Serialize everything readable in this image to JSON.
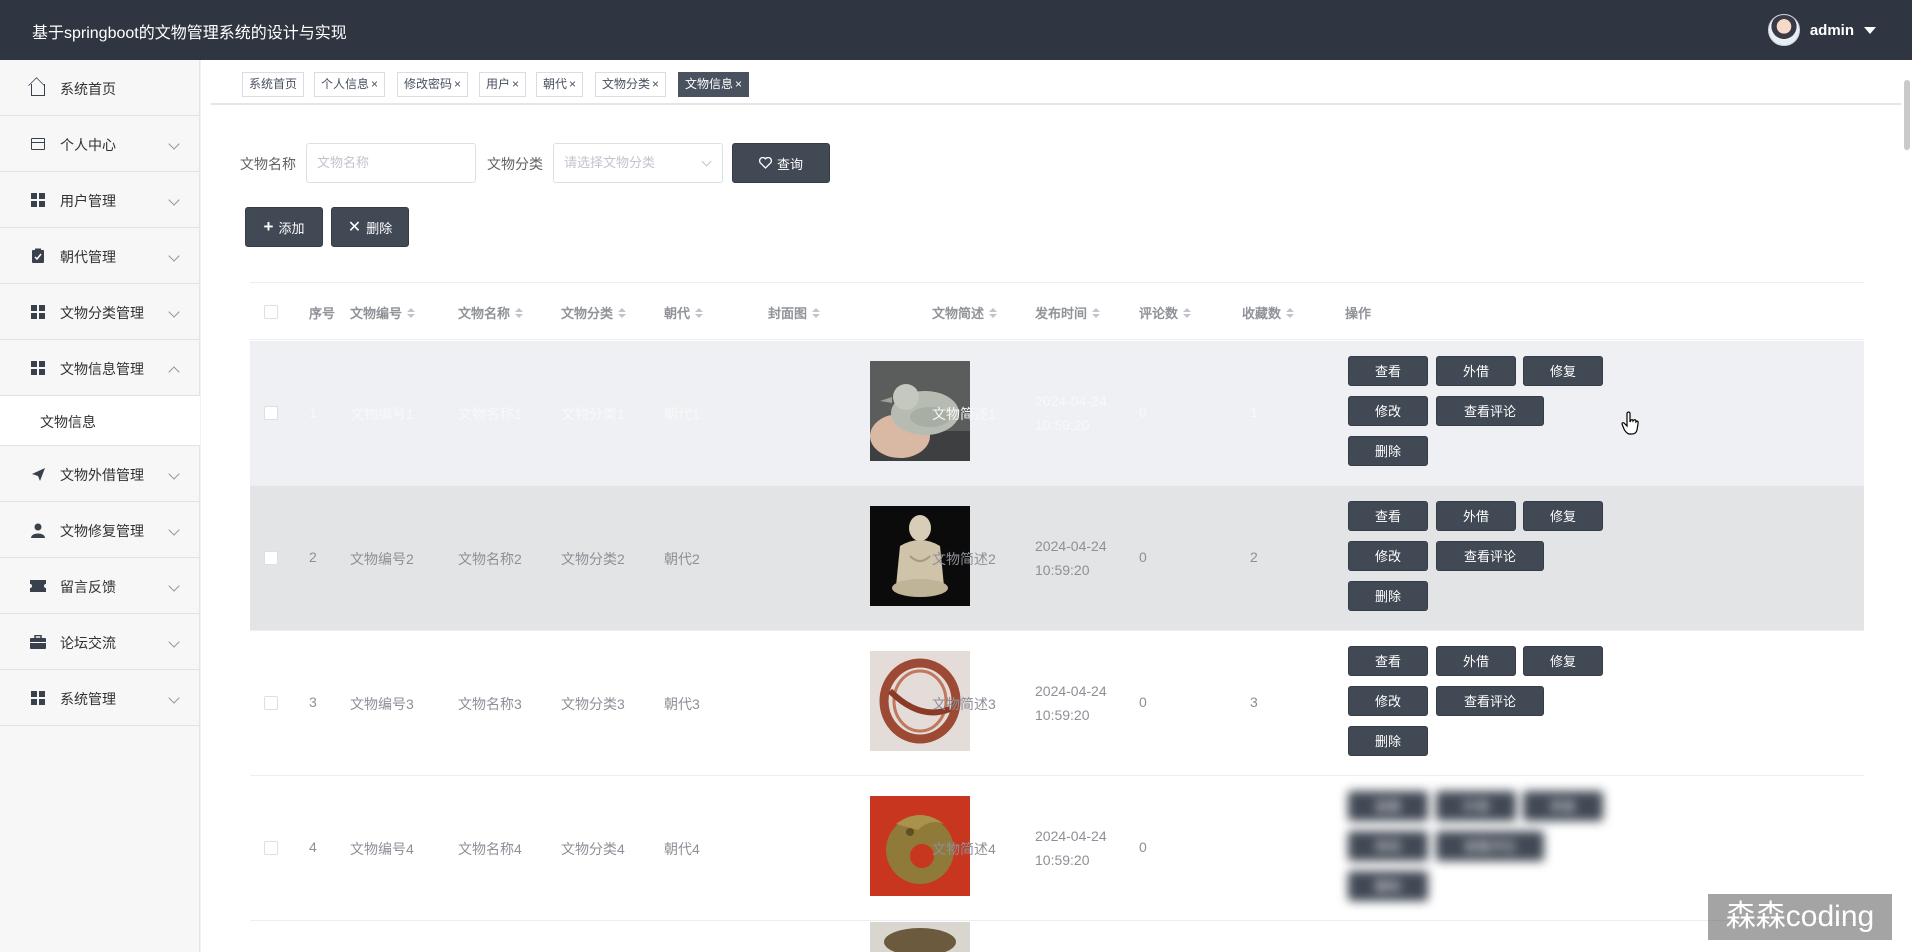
{
  "header": {
    "title": "基于springboot的文物管理系统的设计与实现",
    "username": "admin"
  },
  "sidebar": {
    "items": [
      {
        "label": "系统首页",
        "icon": "home-icon"
      },
      {
        "label": "个人中心",
        "icon": "card-icon"
      },
      {
        "label": "用户管理",
        "icon": "grid-icon"
      },
      {
        "label": "朝代管理",
        "icon": "clipboard-icon"
      },
      {
        "label": "文物分类管理",
        "icon": "grid-icon"
      },
      {
        "label": "文物信息管理",
        "icon": "grid-icon"
      },
      {
        "label": "文物外借管理",
        "icon": "send-icon"
      },
      {
        "label": "文物修复管理",
        "icon": "user-icon"
      },
      {
        "label": "留言反馈",
        "icon": "ticket-icon"
      },
      {
        "label": "论坛交流",
        "icon": "briefcase-icon"
      },
      {
        "label": "系统管理",
        "icon": "grid-icon"
      }
    ],
    "subitem": "文物信息"
  },
  "tabs": [
    "系统首页",
    "个人信息",
    "修改密码",
    "用户",
    "朝代",
    "文物分类",
    "文物信息"
  ],
  "tab_close": "×",
  "search": {
    "name_label": "文物名称",
    "name_placeholder": "文物名称",
    "category_label": "文物分类",
    "category_placeholder": "请选择文物分类",
    "query_button": "查询"
  },
  "actions": {
    "add": "添加",
    "delete": "删除"
  },
  "table": {
    "headers": [
      "序号",
      "文物编号",
      "文物名称",
      "文物分类",
      "朝代",
      "封面图",
      "文物简述",
      "发布时间",
      "评论数",
      "收藏数",
      "操作"
    ],
    "op_buttons": [
      "查看",
      "外借",
      "修复",
      "修改",
      "查看评论",
      "删除"
    ],
    "rows": [
      {
        "index": "1",
        "code": "文物编号1",
        "name": "文物名称1",
        "category": "文物分类1",
        "dynasty": "朝代1",
        "desc": "文物简述1",
        "time": "2024-04-24 10:59:20",
        "comments": "0",
        "favorites": "1"
      },
      {
        "index": "2",
        "code": "文物编号2",
        "name": "文物名称2",
        "category": "文物分类2",
        "dynasty": "朝代2",
        "desc": "文物简述2",
        "time": "2024-04-24 10:59:20",
        "comments": "0",
        "favorites": "2"
      },
      {
        "index": "3",
        "code": "文物编号3",
        "name": "文物名称3",
        "category": "文物分类3",
        "dynasty": "朝代3",
        "desc": "文物简述3",
        "time": "2024-04-24 10:59:20",
        "comments": "0",
        "favorites": "3"
      },
      {
        "index": "4",
        "code": "文物编号4",
        "name": "文物名称4",
        "category": "文物分类4",
        "dynasty": "朝代4",
        "desc": "文物简述4",
        "time": "2024-04-24 10:59:20",
        "comments": "0",
        "favorites": ""
      }
    ]
  },
  "watermark": "森森coding"
}
